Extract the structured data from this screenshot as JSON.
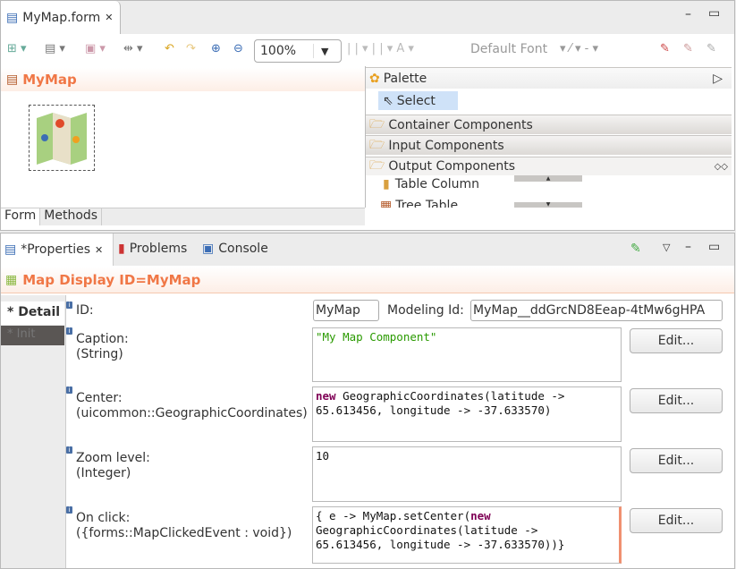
{
  "editor": {
    "tab_label": "MyMap.form",
    "zoom": "100%",
    "font": "Default Font",
    "form_title": "MyMap",
    "bottom_tabs": [
      "Form",
      "Methods"
    ]
  },
  "palette": {
    "title": "Palette",
    "select": "Select",
    "groups": [
      "Container Components",
      "Input Components",
      "Output Components"
    ],
    "items": [
      "Table Column",
      "Tree Table"
    ]
  },
  "views": {
    "tabs": [
      "*Properties",
      "Problems",
      "Console"
    ]
  },
  "properties": {
    "title": "Map Display ID=MyMap",
    "side_tabs": [
      "* Detail",
      "* Init"
    ],
    "id_label": "ID:",
    "id_value": "MyMap",
    "modeling_label": "Modeling Id:",
    "modeling_value": "MyMap__ddGrcND8Eeap-4tMw6gHPA",
    "edit_label": "Edit...",
    "rows": [
      {
        "label": "Caption:",
        "type": "(String)",
        "value": "\"My Map Component\""
      },
      {
        "label": "Center:",
        "type": "(uicommon::GeographicCoordinates)",
        "kw": "new",
        "value": " GeographicCoordinates(latitude ->\n65.613456, longitude -> -37.633570)"
      },
      {
        "label": "Zoom level:",
        "type": "(Integer)",
        "value": "10"
      },
      {
        "label": "On click:",
        "type": "({forms::MapClickedEvent : void})",
        "pre": "{ e -> MyMap.setCenter(",
        "kw": "new",
        "value": "\nGeographicCoordinates(latitude ->\n65.613456, longitude -> -37.633570))}"
      }
    ]
  },
  "colors": {
    "accent": "#f07746",
    "select_bg": "#cfe2f8"
  }
}
